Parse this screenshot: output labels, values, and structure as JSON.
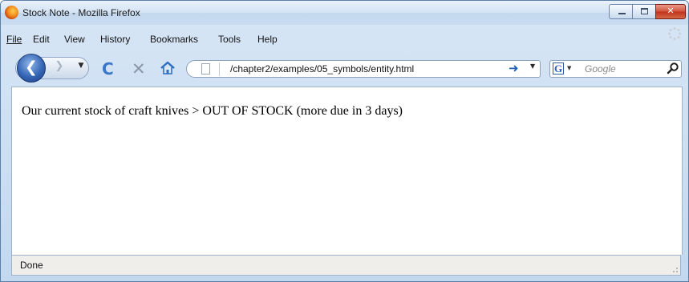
{
  "window": {
    "title": "Stock Note - Mozilla Firefox"
  },
  "window_controls": {
    "minimize_glyph": "",
    "maximize_glyph": "",
    "close_glyph": "✕"
  },
  "menu": {
    "items": [
      {
        "label": "File"
      },
      {
        "label": "Edit"
      },
      {
        "label": "View"
      },
      {
        "label": "History"
      },
      {
        "label": "Bookmarks"
      },
      {
        "label": "Tools"
      },
      {
        "label": "Help"
      }
    ]
  },
  "navigation": {
    "back_glyph": "❮",
    "forward_glyph": "❯",
    "dropdown_glyph": "▼",
    "reload_glyph": "C",
    "stop_glyph": "✕",
    "go_glyph": "➜"
  },
  "address_bar": {
    "url": "/chapter2/examples/05_symbols/entity.html"
  },
  "search_bar": {
    "engine_letter": "G",
    "placeholder": "Google"
  },
  "page": {
    "text": "Our current stock of craft knives > OUT OF STOCK (more due in 3 days)"
  },
  "status_bar": {
    "text": "Done"
  },
  "icons": {
    "app": "firefox-icon",
    "back": "back-arrow-icon",
    "forward": "forward-arrow-icon",
    "reload": "reload-icon",
    "stop": "stop-icon",
    "home": "home-icon",
    "page": "page-icon",
    "go": "go-arrow-icon",
    "search": "magnifier-icon",
    "throbber": "throbber-icon",
    "resize": "resize-grip-icon"
  },
  "colors": {
    "accent": "#3a77c8",
    "close_button": "#c0301a",
    "frame": "#c3d8ef"
  }
}
